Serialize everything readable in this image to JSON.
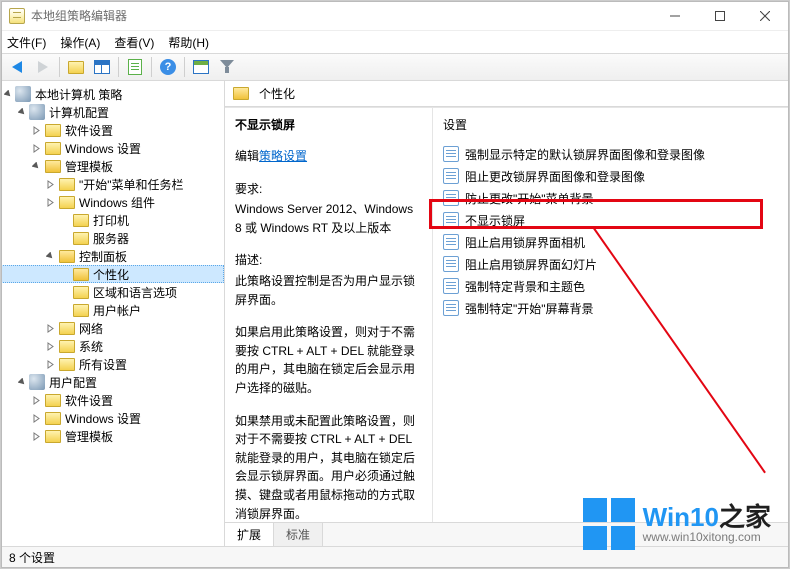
{
  "window": {
    "title": "本地组策略编辑器"
  },
  "menu": {
    "file": "文件(F)",
    "action": "操作(A)",
    "view": "查看(V)",
    "help": "帮助(H)"
  },
  "tree": {
    "root": "本地计算机 策略",
    "computer_cfg": "计算机配置",
    "software": "软件设置",
    "win_settings": "Windows 设置",
    "admin_templates": "管理模板",
    "start_taskbar": "\"开始\"菜单和任务栏",
    "win_components": "Windows 组件",
    "printers": "打印机",
    "servers": "服务器",
    "control_panel": "控制面板",
    "personalization": "个性化",
    "region_language": "区域和语言选项",
    "user_accounts": "用户帐户",
    "network": "网络",
    "system": "系统",
    "all_settings": "所有设置",
    "user_cfg": "用户配置",
    "u_software": "软件设置",
    "u_win_settings": "Windows 设置",
    "u_admin_templates": "管理模板"
  },
  "right": {
    "path_title": "个性化",
    "setting_title": "不显示锁屏",
    "edit_link_prefix": "编辑",
    "edit_link": "策略设置",
    "req_label": "要求:",
    "req_text": "Windows Server 2012、Windows 8 或 Windows RT 及以上版本",
    "desc_label": "描述:",
    "desc_text": "此策略设置控制是否为用户显示锁屏界面。",
    "desc_para2": "如果启用此策略设置，则对于不需要按 CTRL + ALT + DEL  就能登录的用户，其电脑在锁定后会显示用户选择的磁贴。",
    "desc_para3": "如果禁用或未配置此策略设置，则对于不需要按 CTRL + ALT + DEL 就能登录的用户，其电脑在锁定后会显示锁屏界面。用户必须通过触摸、键盘或者用鼠标拖动的方式取消锁屏界面。",
    "col_setting": "设置",
    "items": [
      "强制显示特定的默认锁屏界面图像和登录图像",
      "阻止更改锁屏界面图像和登录图像",
      "防止更改\"开始\"菜单背景",
      "不显示锁屏",
      "阻止启用锁屏界面相机",
      "阻止启用锁屏界面幻灯片",
      "强制特定背景和主题色",
      "强制特定\"开始\"屏幕背景"
    ],
    "tab_extended": "扩展",
    "tab_standard": "标准"
  },
  "status": {
    "text": "8 个设置"
  },
  "watermark": {
    "brand_a": "Win10",
    "brand_b": "之家",
    "url": "www.win10xitong.com"
  }
}
